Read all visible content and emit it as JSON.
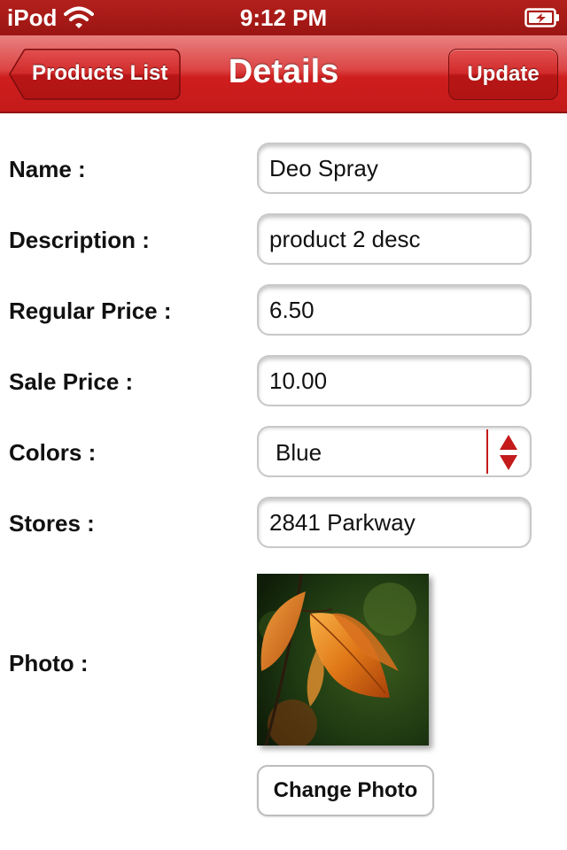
{
  "status_bar": {
    "carrier": "iPod",
    "time": "9:12 PM",
    "icons": [
      "wifi-icon",
      "battery-charging-icon"
    ]
  },
  "nav_bar": {
    "back_label": "Products List",
    "title": "Details",
    "action_label": "Update"
  },
  "form": {
    "name": {
      "label": "Name :",
      "value": "Deo Spray"
    },
    "description": {
      "label": "Description :",
      "value": "product 2 desc"
    },
    "regular_price": {
      "label": "Regular Price :",
      "value": "6.50"
    },
    "sale_price": {
      "label": "Sale Price :",
      "value": "10.00"
    },
    "colors": {
      "label": "Colors :",
      "value": "Blue"
    },
    "stores": {
      "label": "Stores :",
      "value": "2841 Parkway"
    },
    "photo": {
      "label": "Photo :",
      "change_label": "Change Photo"
    }
  },
  "colors": {
    "nav_red": "#c41a1a",
    "status_red": "#9b1512"
  }
}
